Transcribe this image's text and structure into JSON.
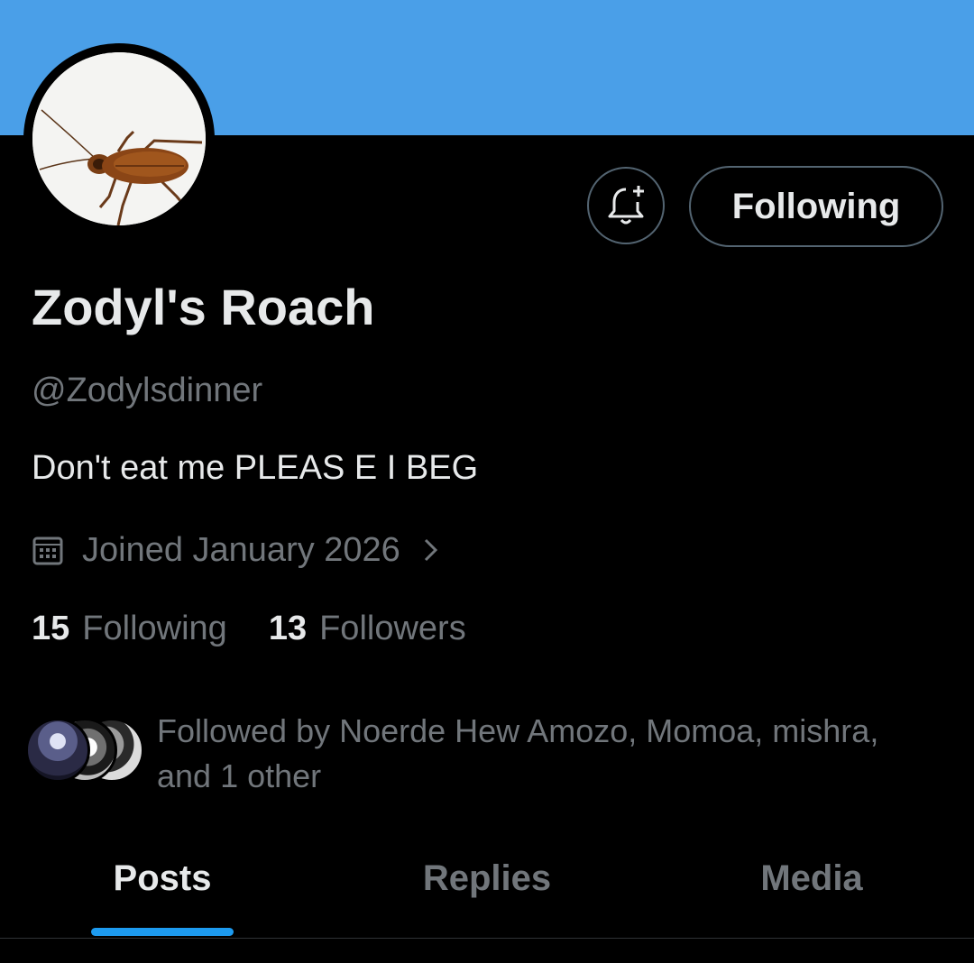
{
  "profile": {
    "display_name": "Zodyl's Roach",
    "handle": "@Zodylsdinner",
    "bio": "Don't eat me PLEAS E I BEG",
    "joined": "Joined January 2026"
  },
  "actions": {
    "following_button": "Following",
    "notify_icon": "bell-plus-icon"
  },
  "stats": {
    "following_count": "15",
    "following_label": "Following",
    "followers_count": "13",
    "followers_label": "Followers"
  },
  "followed_by": {
    "text": "Followed by Noerde Hew Amozo, Momoa, mishra, and 1 other"
  },
  "tabs": [
    {
      "label": "Posts",
      "active": true
    },
    {
      "label": "Replies",
      "active": false
    },
    {
      "label": "Media",
      "active": false
    }
  ],
  "colors": {
    "banner": "#4a9fe8",
    "accent": "#1d9bf0",
    "background": "#000000",
    "secondary_text": "#71767b"
  }
}
